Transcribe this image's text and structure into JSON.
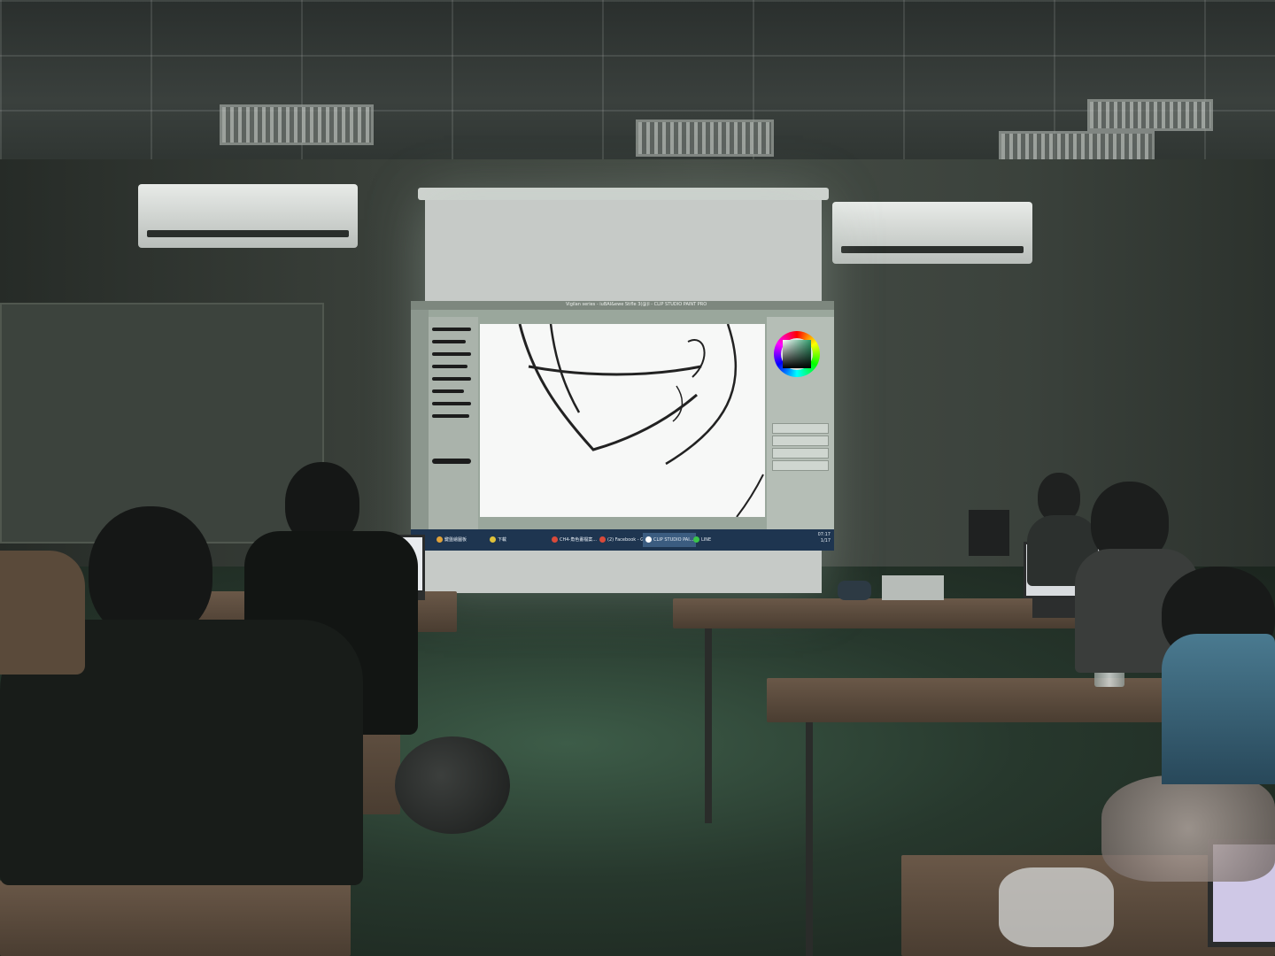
{
  "scene": {
    "description_colors": {
      "screen_glow": "#c6cac7",
      "floor_tint": "#3d5c48",
      "wall": "#3a403a"
    }
  },
  "projection": {
    "window_title": "Vigilan series - iuBAI&ewe Stifle 3(@)l - CLIP STUDIO PAINT PRO",
    "taskbar": {
      "items": [
        {
          "label": "鍵盤繪圖板",
          "icon_color": "#e0a23a"
        },
        {
          "label": "下載",
          "icon_color": "#e0c23a"
        },
        {
          "label": "CH4-角色畫檔案...",
          "icon_color": "#d94a3a"
        },
        {
          "label": "(2) Facebook - G...",
          "icon_color": "#d94a3a"
        },
        {
          "label": "CLIP STUDIO PAI...",
          "icon_color": "#ffffff"
        },
        {
          "label": "LINE",
          "icon_color": "#3ac44a"
        }
      ],
      "time": "07:17",
      "date": "1/17"
    }
  }
}
